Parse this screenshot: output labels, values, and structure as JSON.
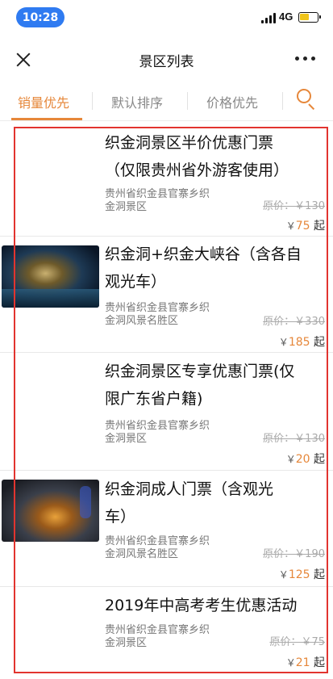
{
  "status_bar": {
    "time": "10:28",
    "network": "4G"
  },
  "nav": {
    "title": "景区列表"
  },
  "sort_tabs": [
    {
      "label": "销量优先",
      "active": true
    },
    {
      "label": "默认排序",
      "active": false
    },
    {
      "label": "价格优先",
      "active": false
    }
  ],
  "colors": {
    "accent": "#e6873a",
    "highlight": "#e2342f",
    "time_pill": "#2f7bf1"
  },
  "items": [
    {
      "title": "织金洞景区半价优惠门票（仅限贵州省外游客使用）",
      "title_line1": "织金洞景区半价优惠门票",
      "title_line2": "（仅限贵州省外游客使用）",
      "address_line1": "贵州省织金县官寨乡织",
      "address_line2": "金洞景区",
      "original_price": "原价：￥130",
      "currency": "￥",
      "price": "75",
      "price_suffix": "起",
      "has_image": false
    },
    {
      "title_line1": "织金洞+织金大峡谷（含各自",
      "title_line2": "观光车）",
      "address_line1": "贵州省织金县官寨乡织",
      "address_line2": "金洞风景名胜区",
      "original_price": "原价：￥330",
      "currency": "￥",
      "price": "185",
      "price_suffix": "起",
      "has_image": true
    },
    {
      "title_line1": "织金洞景区专享优惠门票(仅",
      "title_line2": "限广东省户籍)",
      "address_line1": "贵州省织金县官寨乡织",
      "address_line2": "金洞景区",
      "original_price": "原价：￥130",
      "currency": "￥",
      "price": "20",
      "price_suffix": "起",
      "has_image": false
    },
    {
      "title_line1": "织金洞成人门票（含观光",
      "title_line2": "车）",
      "address_line1": "贵州省织金县官寨乡织",
      "address_line2": "金洞风景名胜区",
      "original_price": "原价：￥190",
      "currency": "￥",
      "price": "125",
      "price_suffix": "起",
      "has_image": true
    },
    {
      "title_line1": "2019年中高考考生优惠活动",
      "address_line1": "贵州省织金县官寨乡织",
      "address_line2": "金洞景区",
      "original_price": "原价：￥75",
      "currency": "￥",
      "price": "21",
      "price_suffix": "起",
      "has_image": false
    }
  ]
}
